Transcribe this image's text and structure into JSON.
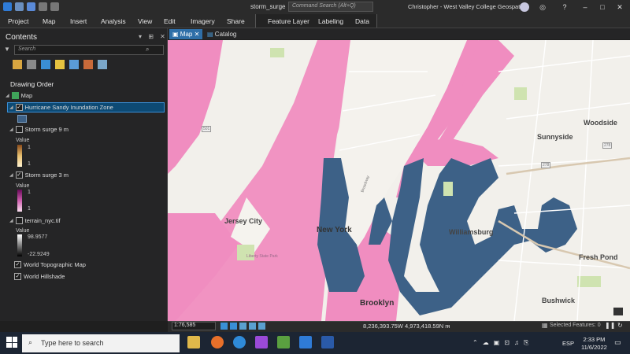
{
  "titlebar": {
    "document_title": "storm_surge",
    "command_search_placeholder": "Command Search (Alt+Q)",
    "user": "Christopher - West Valley College Geospatial"
  },
  "ribbon": {
    "tabs": [
      "Project",
      "Map",
      "Insert",
      "Analysis",
      "View",
      "Edit",
      "Imagery",
      "Share"
    ],
    "context_tabs": [
      "Feature Layer",
      "Labeling",
      "Data"
    ]
  },
  "contents": {
    "title": "Contents",
    "search_placeholder": "Search",
    "drawing_order": "Drawing Order",
    "map_label": "Map",
    "layers": [
      {
        "name": "Hurricane Sandy Inundation Zone",
        "checked": true
      },
      {
        "name": "Storm surge 9 m",
        "checked": false,
        "legend_title": "Value",
        "max": "1",
        "min": "1"
      },
      {
        "name": "Storm surge 3 m",
        "checked": true,
        "legend_title": "Value",
        "max": "1",
        "min": "1"
      },
      {
        "name": "terrain_nyc.tif",
        "checked": false,
        "legend_title": "Value",
        "max": "98.9577",
        "min": "-22.9249"
      },
      {
        "name": "World Topographic Map",
        "checked": true
      },
      {
        "name": "World Hillshade",
        "checked": true
      }
    ]
  },
  "map_tabs": {
    "map": "Map",
    "catalog": "Catalog"
  },
  "map_labels": {
    "new_york": "New York",
    "jersey_city": "Jersey City",
    "brooklyn": "Brooklyn",
    "williamsburg": "Williamsburg",
    "sunnyside": "Sunnyside",
    "woodside": "Woodside",
    "fresh_pond": "Fresh Pond",
    "bushwick": "Bushwick",
    "liberty_park": "Liberty State Park",
    "broadway": "Broadway",
    "route_278_a": "278",
    "route_278_b": "278",
    "route_501": "501"
  },
  "status": {
    "scale": "1:76,585",
    "coordinates": "8,236,393.75W 4,973,418.59N m",
    "selected": "Selected Features: 0"
  },
  "taskbar": {
    "search_placeholder": "Type here to search",
    "language": "ESP",
    "time": "2:33 PM",
    "date": "11/6/2022"
  },
  "colors": {
    "inundation_blue": "#3d6187",
    "surge_pink": "#f08dc0",
    "selection": "#0d4a74"
  }
}
